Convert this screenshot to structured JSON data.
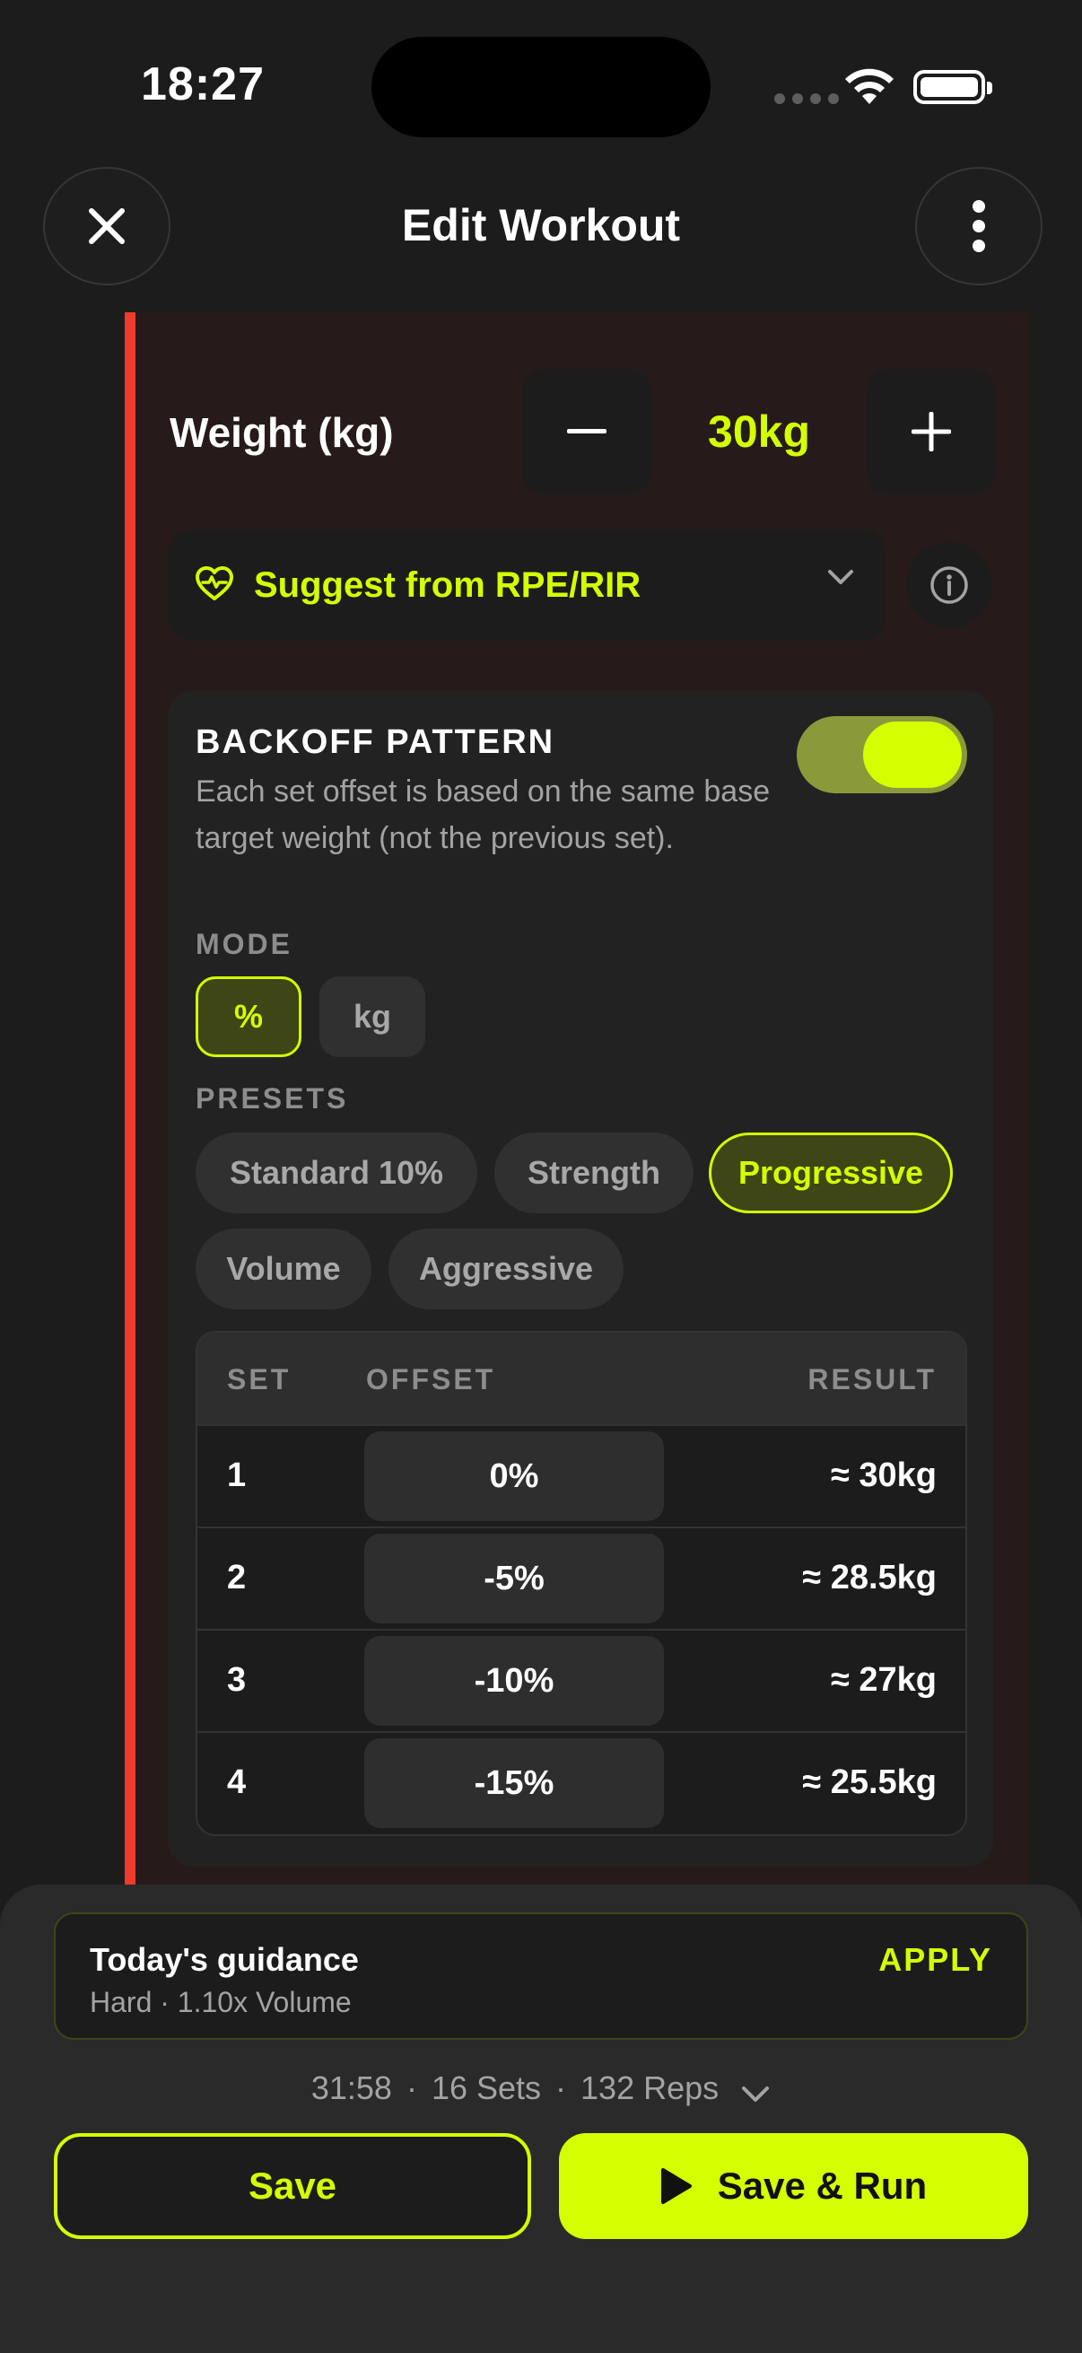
{
  "status_bar": {
    "time": "18:27"
  },
  "header": {
    "title": "Edit Workout"
  },
  "weight": {
    "label": "Weight (kg)",
    "value": "30kg"
  },
  "suggest": {
    "label": "Suggest from RPE/RIR"
  },
  "backoff": {
    "title": "BACKOFF PATTERN",
    "description": "Each set offset is based on the same base target weight (not the previous set).",
    "enabled": true,
    "mode_label": "MODE",
    "modes": [
      "%",
      "kg"
    ],
    "selected_mode": "%",
    "presets_label": "PRESETS",
    "presets": [
      "Standard 10%",
      "Strength",
      "Progressive",
      "Volume",
      "Aggressive"
    ],
    "selected_preset": "Progressive"
  },
  "table": {
    "headers": {
      "set": "SET",
      "offset": "OFFSET",
      "result": "RESULT"
    },
    "rows": [
      {
        "set": "1",
        "offset": "0%",
        "result": "≈ 30kg"
      },
      {
        "set": "2",
        "offset": "-5%",
        "result": "≈ 28.5kg"
      },
      {
        "set": "3",
        "offset": "-10%",
        "result": "≈ 27kg"
      },
      {
        "set": "4",
        "offset": "-15%",
        "result": "≈ 25.5kg"
      }
    ]
  },
  "guidance": {
    "title": "Today's guidance",
    "subtitle": "Hard · 1.10x Volume",
    "apply": "APPLY"
  },
  "summary": {
    "duration": "31:58",
    "sets": "16 Sets",
    "reps": "132 Reps",
    "separator": "·"
  },
  "actions": {
    "save": "Save",
    "save_run": "Save & Run"
  },
  "colors": {
    "accent": "#d4ff00",
    "card_strip": "#ef3b2c",
    "background": "#1c1c1c"
  }
}
